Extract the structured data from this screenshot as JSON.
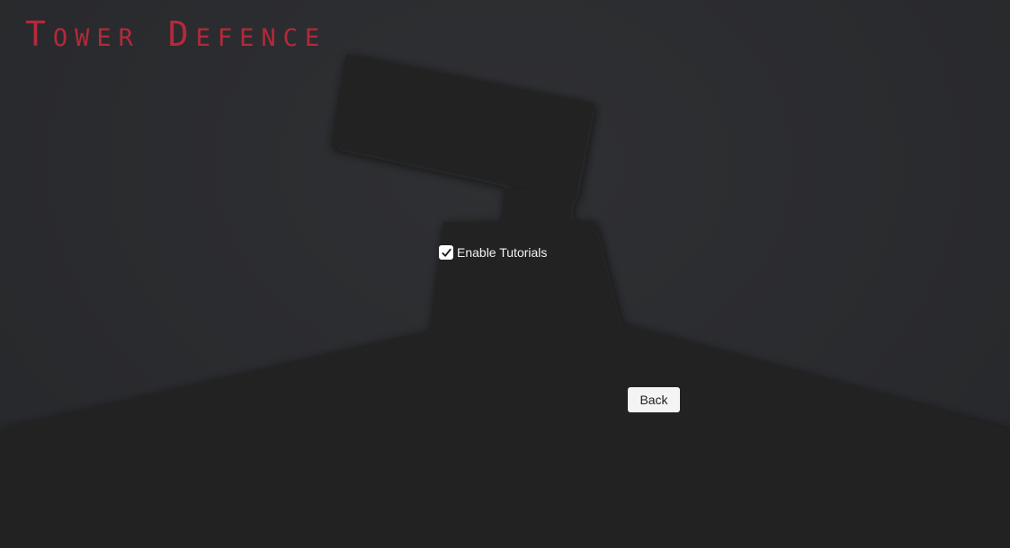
{
  "game": {
    "title": "Tower Defence"
  },
  "settings": {
    "tutorials_toggle": {
      "label": "Enable Tutorials",
      "checked": true
    },
    "back_label": "Back"
  },
  "colors": {
    "title": "#b5293a",
    "background": "#2b2c2f",
    "silhouette": "#232123"
  }
}
